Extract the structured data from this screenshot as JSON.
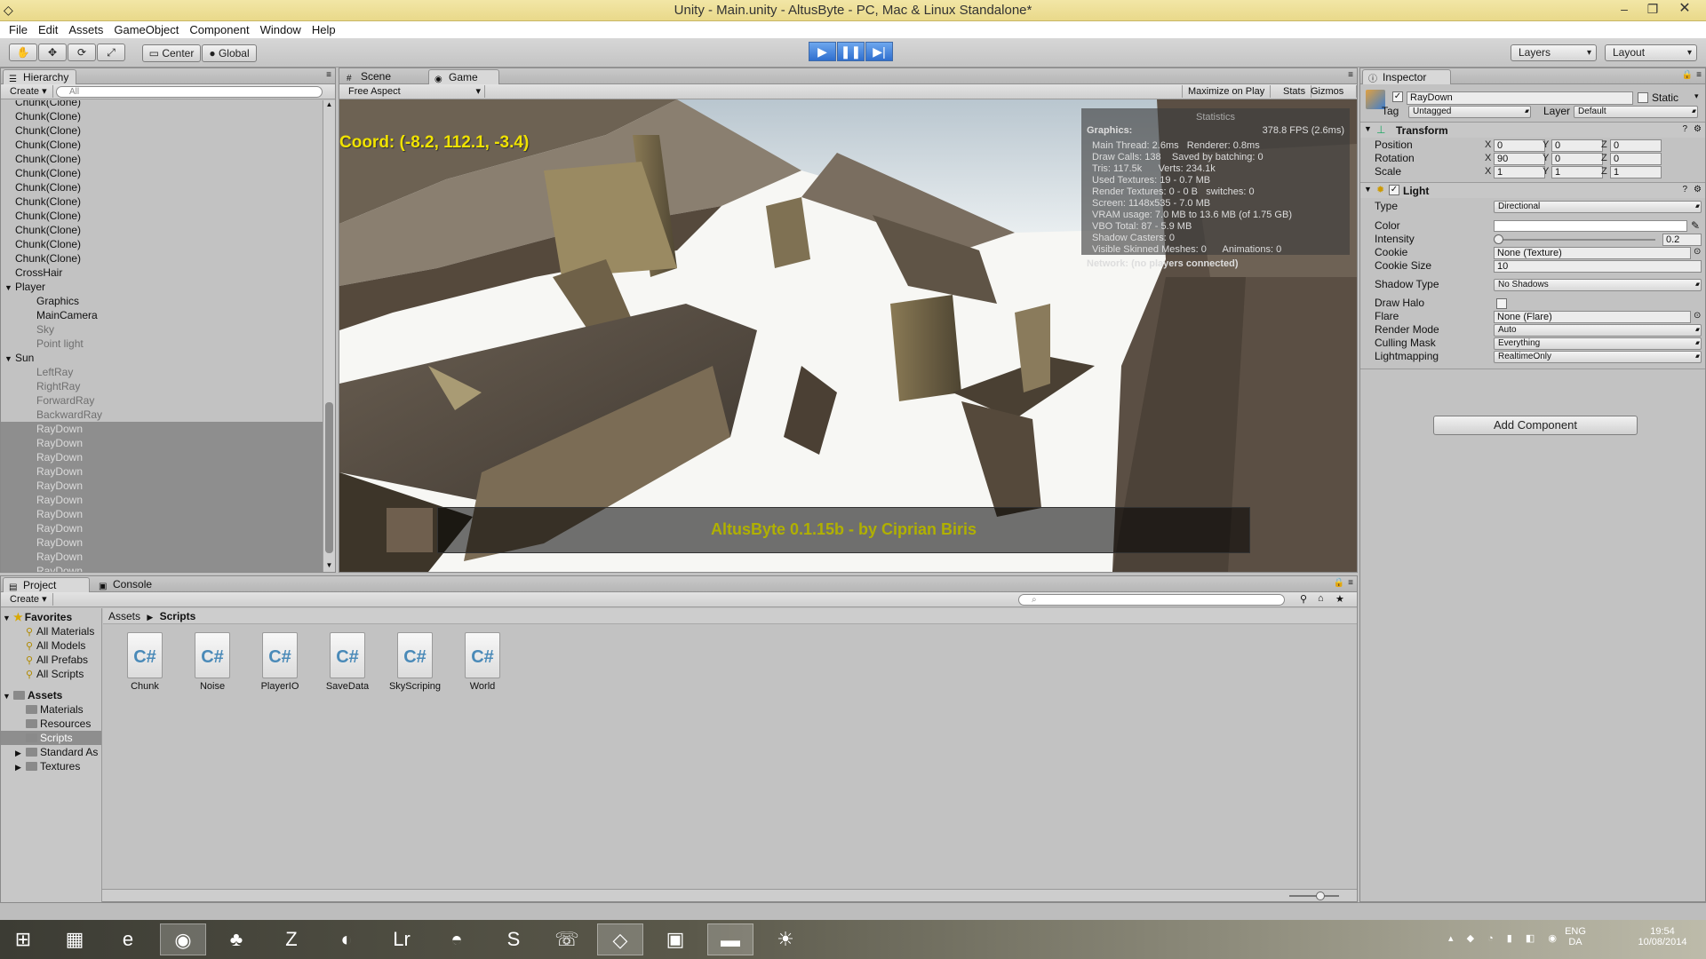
{
  "window": {
    "title": "Unity - Main.unity - AltusByte - PC, Mac & Linux Standalone*"
  },
  "menu": [
    "File",
    "Edit",
    "Assets",
    "GameObject",
    "Component",
    "Window",
    "Help"
  ],
  "toolbar": {
    "center_label": "Center",
    "global_label": "Global",
    "layers_label": "Layers",
    "layout_label": "Layout"
  },
  "hierarchy": {
    "tab_label": "Hierarchy",
    "create_label": "Create",
    "search_placeholder": "All",
    "items": [
      {
        "label": "Chunk(Clone)",
        "indent": 0,
        "expander": "",
        "selected": false,
        "dim": false
      },
      {
        "label": "Chunk(Clone)",
        "indent": 0,
        "expander": "",
        "selected": false,
        "dim": false
      },
      {
        "label": "Chunk(Clone)",
        "indent": 0,
        "expander": "",
        "selected": false,
        "dim": false
      },
      {
        "label": "Chunk(Clone)",
        "indent": 0,
        "expander": "",
        "selected": false,
        "dim": false
      },
      {
        "label": "Chunk(Clone)",
        "indent": 0,
        "expander": "",
        "selected": false,
        "dim": false
      },
      {
        "label": "Chunk(Clone)",
        "indent": 0,
        "expander": "",
        "selected": false,
        "dim": false
      },
      {
        "label": "Chunk(Clone)",
        "indent": 0,
        "expander": "",
        "selected": false,
        "dim": false
      },
      {
        "label": "Chunk(Clone)",
        "indent": 0,
        "expander": "",
        "selected": false,
        "dim": false
      },
      {
        "label": "Chunk(Clone)",
        "indent": 0,
        "expander": "",
        "selected": false,
        "dim": false
      },
      {
        "label": "Chunk(Clone)",
        "indent": 0,
        "expander": "",
        "selected": false,
        "dim": false
      },
      {
        "label": "Chunk(Clone)",
        "indent": 0,
        "expander": "",
        "selected": false,
        "dim": false
      },
      {
        "label": "Chunk(Clone)",
        "indent": 0,
        "expander": "",
        "selected": false,
        "dim": false
      },
      {
        "label": "CrossHair",
        "indent": 0,
        "expander": "",
        "selected": false,
        "dim": false
      },
      {
        "label": "Player",
        "indent": 0,
        "expander": "▼",
        "selected": false,
        "dim": false
      },
      {
        "label": "Graphics",
        "indent": 1,
        "expander": "",
        "selected": false,
        "dim": false
      },
      {
        "label": "MainCamera",
        "indent": 1,
        "expander": "",
        "selected": false,
        "dim": false
      },
      {
        "label": "Sky",
        "indent": 1,
        "expander": "",
        "selected": false,
        "dim": true
      },
      {
        "label": "Point light",
        "indent": 1,
        "expander": "",
        "selected": false,
        "dim": true
      },
      {
        "label": "Sun",
        "indent": 0,
        "expander": "▼",
        "selected": false,
        "dim": false
      },
      {
        "label": "LeftRay",
        "indent": 1,
        "expander": "",
        "selected": false,
        "dim": true
      },
      {
        "label": "RightRay",
        "indent": 1,
        "expander": "",
        "selected": false,
        "dim": true
      },
      {
        "label": "ForwardRay",
        "indent": 1,
        "expander": "",
        "selected": false,
        "dim": true
      },
      {
        "label": "BackwardRay",
        "indent": 1,
        "expander": "",
        "selected": false,
        "dim": true
      },
      {
        "label": "RayDown",
        "indent": 1,
        "expander": "",
        "selected": true,
        "dim": true
      },
      {
        "label": "RayDown",
        "indent": 1,
        "expander": "",
        "selected": true,
        "dim": true
      },
      {
        "label": "RayDown",
        "indent": 1,
        "expander": "",
        "selected": true,
        "dim": true
      },
      {
        "label": "RayDown",
        "indent": 1,
        "expander": "",
        "selected": true,
        "dim": true
      },
      {
        "label": "RayDown",
        "indent": 1,
        "expander": "",
        "selected": true,
        "dim": true
      },
      {
        "label": "RayDown",
        "indent": 1,
        "expander": "",
        "selected": true,
        "dim": true
      },
      {
        "label": "RayDown",
        "indent": 1,
        "expander": "",
        "selected": true,
        "dim": true
      },
      {
        "label": "RayDown",
        "indent": 1,
        "expander": "",
        "selected": true,
        "dim": true
      },
      {
        "label": "RayDown",
        "indent": 1,
        "expander": "",
        "selected": true,
        "dim": true
      },
      {
        "label": "RayDown",
        "indent": 1,
        "expander": "",
        "selected": true,
        "dim": true
      },
      {
        "label": "RayDown",
        "indent": 1,
        "expander": "",
        "selected": true,
        "dim": true
      }
    ]
  },
  "game": {
    "scene_tab": "Scene",
    "game_tab": "Game",
    "aspect": "Free Aspect",
    "maximize_label": "Maximize on Play",
    "stats_label": "Stats",
    "gizmos_label": "Gizmos",
    "coord_text": "Coord: (-8.2, 112.1, -3.4)",
    "banner_text": "AltusByte 0.1.15b - by Ciprian Biris",
    "stats": {
      "header": "Statistics",
      "graphics_label": "Graphics:",
      "fps": "378.8 FPS (2.6ms)",
      "lines": [
        "Main Thread: 2.6ms   Renderer: 0.8ms",
        "Draw Calls: 138    Saved by batching: 0",
        "Tris: 117.5k      Verts: 234.1k",
        "Used Textures: 19 - 0.7 MB",
        "Render Textures: 0 - 0 B   switches: 0",
        "Screen: 1148x535 - 7.0 MB",
        "VRAM usage: 7.0 MB to 13.6 MB (of 1.75 GB)",
        "VBO Total: 87 - 5.9 MB",
        "Shadow Casters: 0",
        "Visible Skinned Meshes: 0      Animations: 0"
      ],
      "network": "Network: (no players connected)"
    }
  },
  "inspector": {
    "tab_label": "Inspector",
    "object_name": "RayDown",
    "static_label": "Static",
    "tag_label": "Tag",
    "tag_value": "Untagged",
    "layer_label": "Layer",
    "layer_value": "Default",
    "transform": {
      "title": "Transform",
      "position_label": "Position",
      "position": [
        "0",
        "0",
        "0"
      ],
      "rotation_label": "Rotation",
      "rotation": [
        "90",
        "0",
        "0"
      ],
      "scale_label": "Scale",
      "scale": [
        "1",
        "1",
        "1"
      ]
    },
    "light": {
      "title": "Light",
      "type_label": "Type",
      "type_value": "Directional",
      "color_label": "Color",
      "intensity_label": "Intensity",
      "intensity_value": "0.2",
      "cookie_label": "Cookie",
      "cookie_value": "None (Texture)",
      "cookie_size_label": "Cookie Size",
      "cookie_size_value": "10",
      "shadow_label": "Shadow Type",
      "shadow_value": "No Shadows",
      "halo_label": "Draw Halo",
      "flare_label": "Flare",
      "flare_value": "None (Flare)",
      "render_label": "Render Mode",
      "render_value": "Auto",
      "culling_label": "Culling Mask",
      "culling_value": "Everything",
      "lightmap_label": "Lightmapping",
      "lightmap_value": "RealtimeOnly"
    },
    "add_component": "Add Component"
  },
  "project": {
    "tab_label": "Project",
    "console_label": "Console",
    "create_label": "Create",
    "favorites_label": "Favorites",
    "favorites": [
      "All Materials",
      "All Models",
      "All Prefabs",
      "All Scripts"
    ],
    "assets_label": "Assets",
    "folders": [
      "Materials",
      "Resources",
      "Scripts",
      "Standard As",
      "Textures"
    ],
    "breadcrumb": [
      "Assets",
      "Scripts"
    ],
    "files": [
      {
        "name": "Chunk",
        "icon": "C#"
      },
      {
        "name": "Noise",
        "icon": "C#"
      },
      {
        "name": "PlayerIO",
        "icon": "C#"
      },
      {
        "name": "SaveData",
        "icon": "C#"
      },
      {
        "name": "SkyScriping",
        "icon": "C#"
      },
      {
        "name": "World",
        "icon": "C#"
      }
    ]
  },
  "taskbar": {
    "lang": "ENG",
    "region": "DA",
    "time": "19:54",
    "date": "10/08/2014",
    "apps": [
      "start-icon",
      "media-icon",
      "ie-icon",
      "chrome-icon",
      "game-icon",
      "filezilla-icon",
      "app-icon",
      "lightroom-icon",
      "pokeball-icon",
      "skype-icon",
      "viber-icon",
      "unity-icon",
      "store-icon",
      "explorer-icon",
      "weather-icon"
    ]
  }
}
